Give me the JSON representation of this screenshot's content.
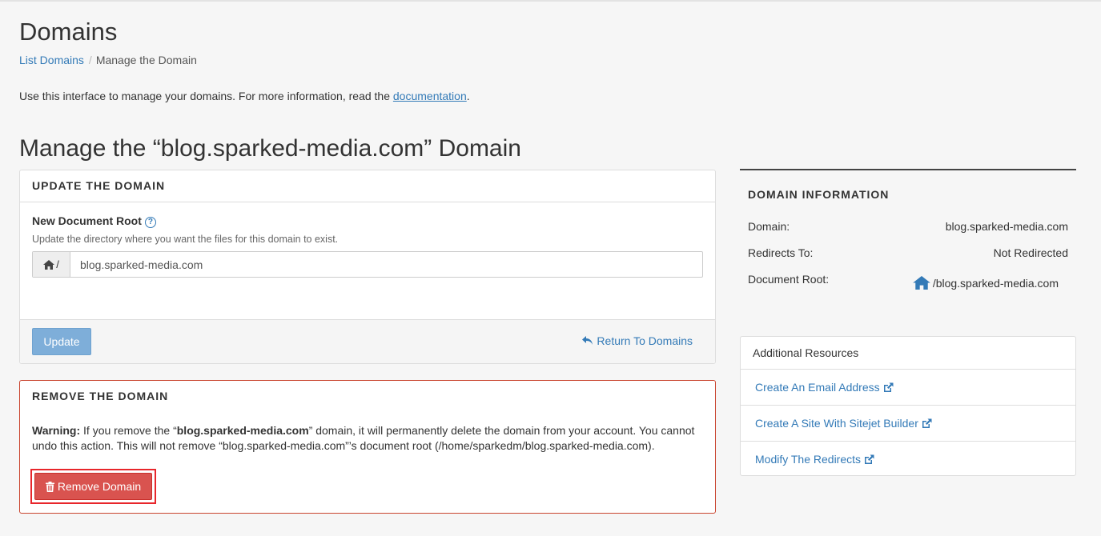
{
  "header": {
    "title": "Domains",
    "breadcrumb": {
      "list_domains": "List Domains",
      "separator": "/",
      "current": "Manage the Domain"
    },
    "intro_text": "Use this interface to manage your domains. For more information, read the ",
    "intro_link": "documentation",
    "intro_end": "."
  },
  "manage_title": "Manage the “blog.sparked-media.com” Domain",
  "update_panel": {
    "heading": "UPDATE THE DOMAIN",
    "field_label": "New Document Root",
    "field_help": "Update the directory where you want the files for this domain to exist.",
    "addon_text": "/",
    "input_value": "blog.sparked-media.com",
    "update_button": "Update",
    "return_link": "Return To Domains"
  },
  "remove_panel": {
    "heading": "REMOVE THE DOMAIN",
    "warning_label": "Warning:",
    "warning_pre": " If you remove the “",
    "warning_domain": "blog.sparked-media.com",
    "warning_post": "” domain, it will permanently delete the domain from your account. You cannot undo this action. This will not remove “blog.sparked-media.com”’s document root (/home/sparkedm/blog.sparked-media.com).",
    "remove_button": "Remove Domain"
  },
  "domain_info": {
    "heading": "DOMAIN INFORMATION",
    "rows": [
      {
        "label": "Domain:",
        "value": "blog.sparked-media.com"
      },
      {
        "label": "Redirects To:",
        "value": "Not Redirected"
      },
      {
        "label": "Document Root:",
        "value": "/blog.sparked-media.com"
      }
    ]
  },
  "resources": {
    "heading": "Additional Resources",
    "items": [
      {
        "label": "Create An Email Address"
      },
      {
        "label": "Create A Site With Sitejet Builder"
      },
      {
        "label": "Modify The Redirects"
      }
    ]
  },
  "colors": {
    "link": "#337ab7",
    "danger": "#d9534f",
    "primary_disabled": "#7eaed9",
    "highlight": "#e8262b"
  }
}
